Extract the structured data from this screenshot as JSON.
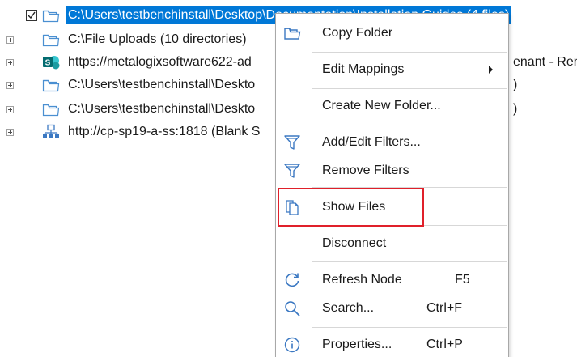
{
  "tree": {
    "rows": [
      {
        "label": "C:\\Users\\testbenchinstall\\Desktop\\Documentation\\Installation Guides (4 files)",
        "selected": true
      },
      {
        "label": "C:\\File Uploads (10 directories)"
      },
      {
        "label": "https://metalogixsoftware622-ad",
        "suffix": "enant - Ren"
      },
      {
        "label": "C:\\Users\\testbenchinstall\\Deskto",
        "suffix": ")"
      },
      {
        "label": "C:\\Users\\testbenchinstall\\Deskto",
        "suffix": ")"
      },
      {
        "label": "http://cp-sp19-a-ss:1818 (Blank S"
      }
    ]
  },
  "context_menu": {
    "items": [
      {
        "label": "Copy Folder",
        "icon": "folder-icon"
      },
      {
        "label": "Edit Mappings",
        "submenu": true
      },
      {
        "label": "Create New Folder..."
      },
      {
        "label": "Add/Edit Filters...",
        "icon": "filter-icon"
      },
      {
        "label": "Remove Filters",
        "icon": "filter-remove-icon"
      },
      {
        "label": "Show Files",
        "icon": "documents-icon"
      },
      {
        "label": "Disconnect"
      },
      {
        "label": "Refresh Node",
        "shortcut": "F5",
        "icon": "refresh-icon"
      },
      {
        "label": "Search...",
        "shortcut": "Ctrl+F",
        "icon": "search-icon"
      },
      {
        "label": "Properties...",
        "shortcut": "Ctrl+P",
        "icon": "info-icon"
      }
    ]
  },
  "colors": {
    "selection": "#0078d7",
    "highlight_box": "#e0202a",
    "icon_blue": "#4a8fd1",
    "sharepoint": "#036c70"
  }
}
